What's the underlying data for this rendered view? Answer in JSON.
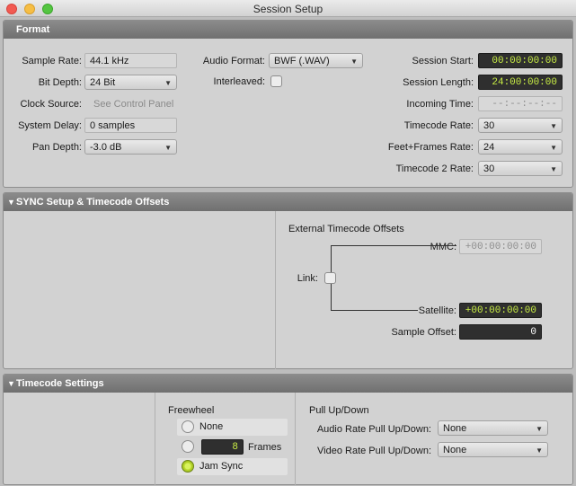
{
  "window": {
    "title": "Session Setup"
  },
  "format": {
    "header": "Format",
    "sample_rate": {
      "label": "Sample Rate:",
      "value": "44.1 kHz"
    },
    "bit_depth": {
      "label": "Bit Depth:",
      "value": "24 Bit"
    },
    "clock_source": {
      "label": "Clock Source:",
      "value": "See Control Panel"
    },
    "system_delay": {
      "label": "System Delay:",
      "value": "0 samples"
    },
    "pan_depth": {
      "label": "Pan Depth:",
      "value": "-3.0 dB"
    },
    "audio_format": {
      "label": "Audio Format:",
      "value": "BWF (.WAV)"
    },
    "interleaved": {
      "label": "Interleaved:",
      "checked": false
    },
    "session_start": {
      "label": "Session Start:",
      "value": "00:00:00:00"
    },
    "session_length": {
      "label": "Session Length:",
      "value": "24:00:00:00"
    },
    "incoming_time": {
      "label": "Incoming Time:",
      "value": "--:--:--:--"
    },
    "timecode_rate": {
      "label": "Timecode Rate:",
      "value": "30"
    },
    "feet_frames_rate": {
      "label": "Feet+Frames Rate:",
      "value": "24"
    },
    "timecode2_rate": {
      "label": "Timecode 2 Rate:",
      "value": "30"
    }
  },
  "sync": {
    "header": "SYNC Setup & Timecode Offsets",
    "offsets_title": "External Timecode Offsets",
    "mmc": {
      "label": "MMC:",
      "value": "+00:00:00:00"
    },
    "link": {
      "label": "Link:",
      "checked": false
    },
    "satellite": {
      "label": "Satellite:",
      "value": "+00:00:00:00"
    },
    "sample_offset": {
      "label": "Sample Offset:",
      "value": "0"
    }
  },
  "timecode": {
    "header": "Timecode Settings",
    "freewheel": {
      "title": "Freewheel",
      "none_label": "None",
      "frames_value": "8",
      "frames_label": "Frames",
      "jam_sync_label": "Jam Sync",
      "selected": "jam_sync"
    },
    "pull": {
      "title": "Pull Up/Down",
      "audio": {
        "label": "Audio Rate Pull Up/Down:",
        "value": "None"
      },
      "video": {
        "label": "Video Rate Pull Up/Down:",
        "value": "None"
      }
    }
  },
  "icons": {
    "dropdown": "chevron-down-icon",
    "disclosure": "disclosure-triangle-icon"
  },
  "colors": {
    "timecode_text": "#c9ee45",
    "header_bg": "#7b7b7b",
    "panel_bg": "#d2d2d2"
  }
}
